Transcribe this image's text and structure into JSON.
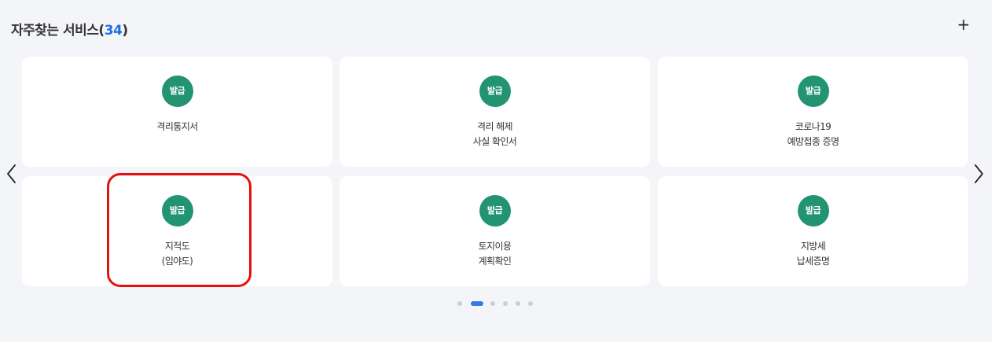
{
  "section": {
    "title": "자주찾는 서비스",
    "count_open": "(",
    "count": "34",
    "count_close": ")",
    "add_icon": "plus-icon",
    "add_label": "+"
  },
  "navigation": {
    "prev_icon": "chevron-left-icon",
    "next_icon": "chevron-right-icon"
  },
  "cards": [
    {
      "badge": "발급",
      "lines": [
        "격리통지서"
      ]
    },
    {
      "badge": "발급",
      "lines": [
        "격리 해제",
        "사실 확인서"
      ]
    },
    {
      "badge": "발급",
      "lines": [
        "코로나19",
        "예방접종 증명"
      ]
    },
    {
      "badge": "발급",
      "lines": [
        "지적도",
        "(임야도)"
      ]
    },
    {
      "badge": "발급",
      "lines": [
        "토지이용",
        "계획확인"
      ]
    },
    {
      "badge": "발급",
      "lines": [
        "지방세",
        "납세증명"
      ]
    }
  ],
  "highlighted_card": 3,
  "pagination": {
    "total": 6,
    "active": 1
  },
  "colors": {
    "badge": "#229471",
    "count": "#1f6fe0",
    "highlight": "#e8100e",
    "active_dot": "#2f7ce6",
    "background": "#f4f5f9"
  }
}
